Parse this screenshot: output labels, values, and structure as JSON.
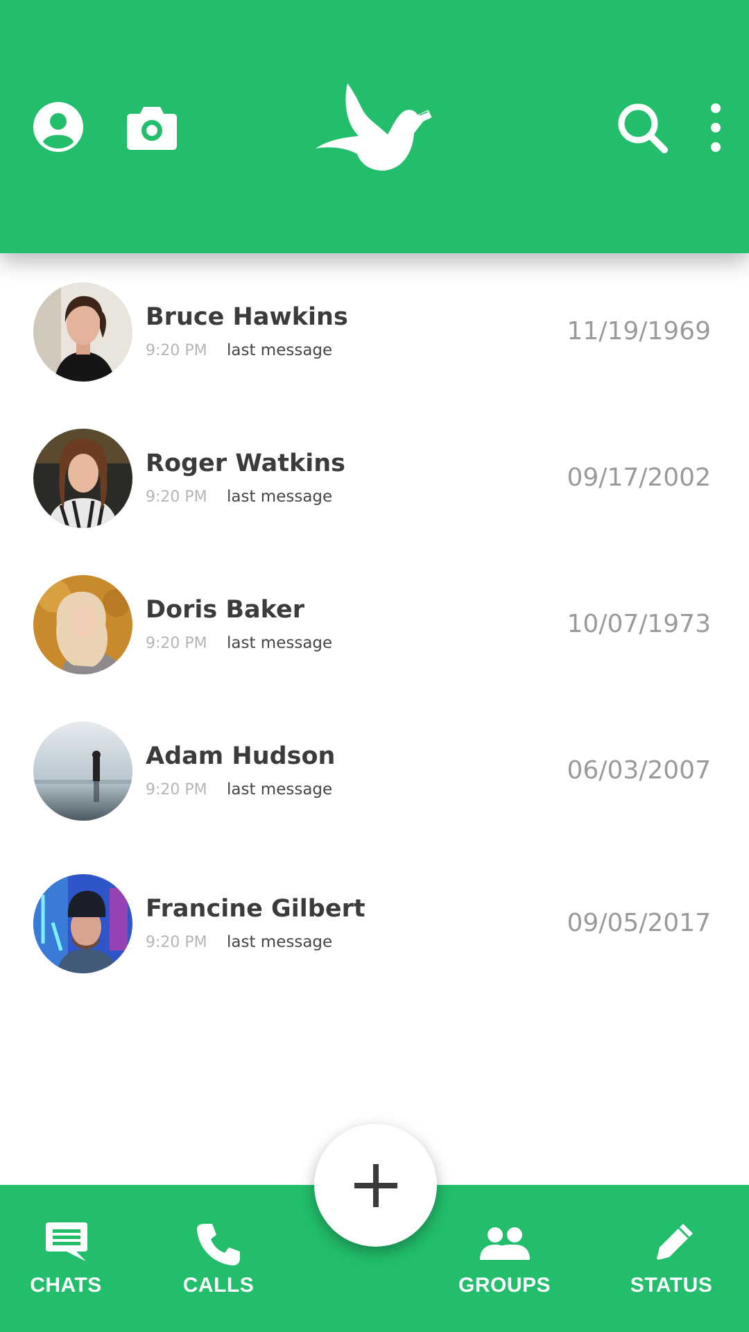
{
  "app": {
    "accent_color": "#22be6b",
    "logo_icon": "dove-icon"
  },
  "header": {
    "left_icons": [
      "profile-icon",
      "camera-icon"
    ],
    "right_icons": [
      "search-icon",
      "more-vert-icon"
    ]
  },
  "chats": [
    {
      "name": "Bruce Hawkins",
      "time": "9:20 PM",
      "last_message": "last message",
      "date": "11/19/1969"
    },
    {
      "name": "Roger Watkins",
      "time": "9:20 PM",
      "last_message": "last message",
      "date": "09/17/2002"
    },
    {
      "name": "Doris Baker",
      "time": "9:20 PM",
      "last_message": "last message",
      "date": "10/07/1973"
    },
    {
      "name": "Adam Hudson",
      "time": "9:20 PM",
      "last_message": "last message",
      "date": "06/03/2007"
    },
    {
      "name": "Francine Gilbert",
      "time": "9:20 PM",
      "last_message": "last message",
      "date": "09/05/2017"
    }
  ],
  "fab": {
    "icon": "plus-icon"
  },
  "bottom_nav": {
    "chats": {
      "label": "CHATS",
      "icon": "chat-icon"
    },
    "calls": {
      "label": "CALLS",
      "icon": "phone-icon"
    },
    "groups": {
      "label": "GROUPS",
      "icon": "groups-icon"
    },
    "status": {
      "label": "STATUS",
      "icon": "pencil-icon"
    }
  }
}
